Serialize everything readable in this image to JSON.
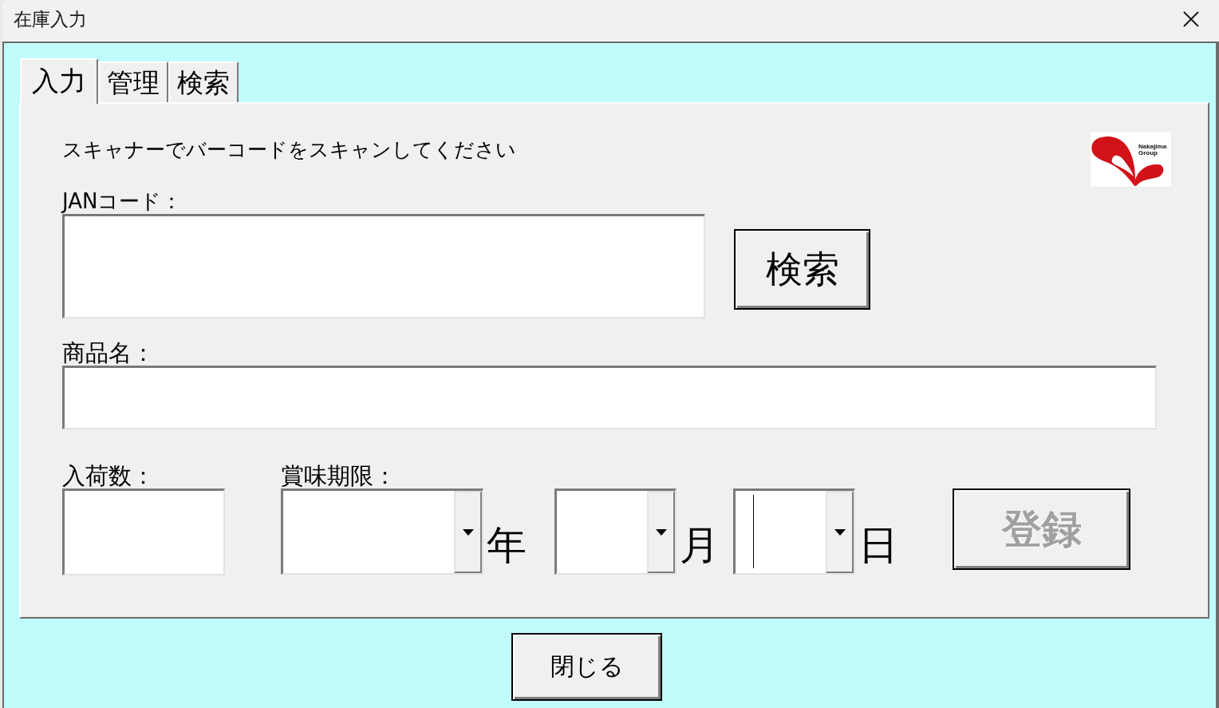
{
  "window": {
    "title": "在庫入力"
  },
  "tabs": [
    {
      "label": "入力",
      "selected": true
    },
    {
      "label": "管理",
      "selected": false
    },
    {
      "label": "検索",
      "selected": false
    }
  ],
  "instruction": "スキャナーでバーコードをスキャンしてください",
  "logo": {
    "text": "Nakajima Group"
  },
  "jan_code": {
    "label": "JANコード："
  },
  "search_button": {
    "label": "検索"
  },
  "product_name": {
    "label": "商品名："
  },
  "quantity": {
    "label": "入荷数："
  },
  "expiry": {
    "label": "賞味期限：",
    "parts": [
      {
        "unit": "年",
        "focused": false
      },
      {
        "unit": "月",
        "focused": false
      },
      {
        "unit": "日",
        "focused": true
      }
    ]
  },
  "register_button": {
    "label": "登録",
    "disabled": true
  },
  "close_button": {
    "label": "閉じる"
  }
}
